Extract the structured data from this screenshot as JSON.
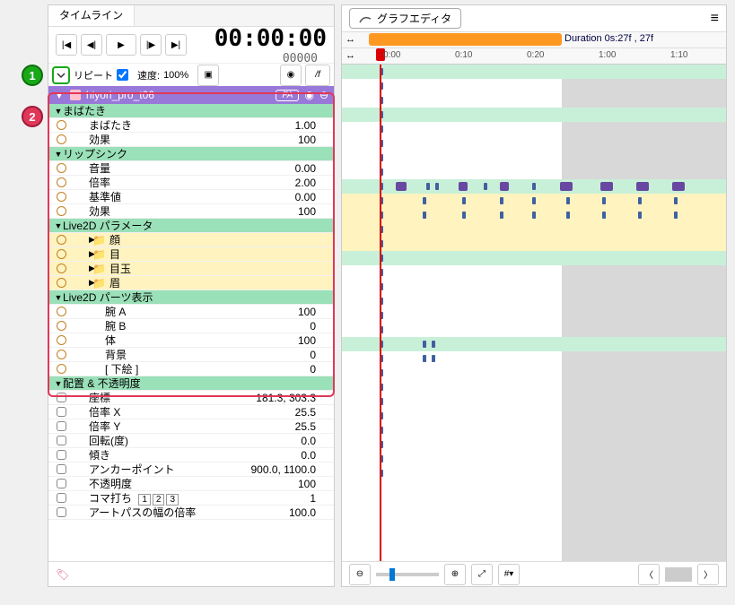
{
  "tab_label": "タイムライン",
  "timecode": "00:00:00",
  "subframe": "00000",
  "repeat_label": "リピート",
  "speed_label": "速度:",
  "speed_value": "100%",
  "f_button": "/f",
  "track_name": "hiyori_pro_t06",
  "fa_badge": "FA",
  "graph_editor_label": "グラフエディタ",
  "duration_label": "Duration 0s:27f , 27f",
  "ticks": [
    "0:00",
    "0:10",
    "0:20",
    "1:00",
    "1:10"
  ],
  "badges": {
    "one": "1",
    "two": "2"
  },
  "sections": {
    "blink": {
      "label": "まばたき",
      "props": [
        {
          "label": "まばたき",
          "val": "1.00"
        },
        {
          "label": "効果",
          "val": "100"
        }
      ]
    },
    "lipsync": {
      "label": "リップシンク",
      "props": [
        {
          "label": "音量",
          "val": "0.00"
        },
        {
          "label": "倍率",
          "val": "2.00"
        },
        {
          "label": "基準値",
          "val": "0.00"
        },
        {
          "label": "効果",
          "val": "100"
        }
      ]
    },
    "live2d_param": {
      "label": "Live2D パラメータ",
      "folders": [
        "顔",
        "目",
        "目玉",
        "眉"
      ]
    },
    "live2d_parts": {
      "label": "Live2D パーツ表示",
      "props": [
        {
          "label": "腕 A",
          "val": "100"
        },
        {
          "label": "腕 B",
          "val": "0"
        },
        {
          "label": "体",
          "val": "100"
        },
        {
          "label": "背景",
          "val": "0"
        },
        {
          "label": "[ 下絵 ]",
          "val": "0"
        }
      ]
    },
    "transform": {
      "label": "配置 & 不透明度",
      "props": [
        {
          "label": "座標",
          "val": "181.3, 303.3"
        },
        {
          "label": "倍率 X",
          "val": "25.5"
        },
        {
          "label": "倍率 Y",
          "val": "25.5"
        },
        {
          "label": "回転(度)",
          "val": "0.0"
        },
        {
          "label": "傾き",
          "val": "0.0"
        },
        {
          "label": "アンカーポイント",
          "val": "900.0, 1100.0"
        },
        {
          "label": "不透明度",
          "val": "100"
        },
        {
          "label": "コマ打ち",
          "val": "1",
          "tags": [
            "1",
            "2",
            "3"
          ]
        },
        {
          "label": "アートパスの幅の倍率",
          "val": "100.0"
        }
      ]
    }
  }
}
